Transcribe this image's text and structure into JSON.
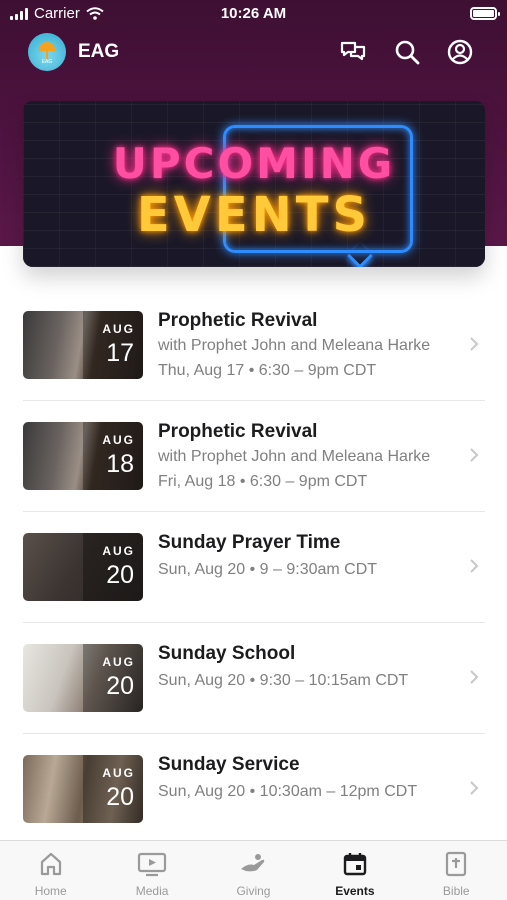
{
  "status_bar": {
    "carrier": "Carrier",
    "time": "10:26 AM"
  },
  "app_bar": {
    "title": "EAG",
    "logo_text": "EAG"
  },
  "banner": {
    "line1": "UPCOMING",
    "line2": "EVENTS"
  },
  "events": [
    {
      "title": "Prophetic Revival",
      "subtitle": "with Prophet John and Meleana Harke",
      "when": "Thu, Aug 17 • 6:30 – 9pm CDT",
      "month": "AUG",
      "day": "17"
    },
    {
      "title": "Prophetic Revival",
      "subtitle": "with Prophet John and Meleana Harke",
      "when": "Fri, Aug 18 • 6:30 – 9pm CDT",
      "month": "AUG",
      "day": "18"
    },
    {
      "title": "Sunday Prayer Time",
      "subtitle": "",
      "when": "Sun, Aug 20 • 9 – 9:30am CDT",
      "month": "AUG",
      "day": "20"
    },
    {
      "title": "Sunday School",
      "subtitle": "",
      "when": "Sun, Aug 20 • 9:30 – 10:15am CDT",
      "month": "AUG",
      "day": "20"
    },
    {
      "title": "Sunday Service",
      "subtitle": "",
      "when": "Sun, Aug 20 • 10:30am – 12pm CDT",
      "month": "AUG",
      "day": "20"
    }
  ],
  "tabs": [
    {
      "label": "Home",
      "icon": "home-icon"
    },
    {
      "label": "Media",
      "icon": "media-icon"
    },
    {
      "label": "Giving",
      "icon": "giving-icon"
    },
    {
      "label": "Events",
      "icon": "calendar-icon",
      "active": true
    },
    {
      "label": "Bible",
      "icon": "bible-icon"
    }
  ],
  "colors": {
    "header": "#4e1340",
    "text": "#1c1c1e",
    "muted": "#808080"
  }
}
